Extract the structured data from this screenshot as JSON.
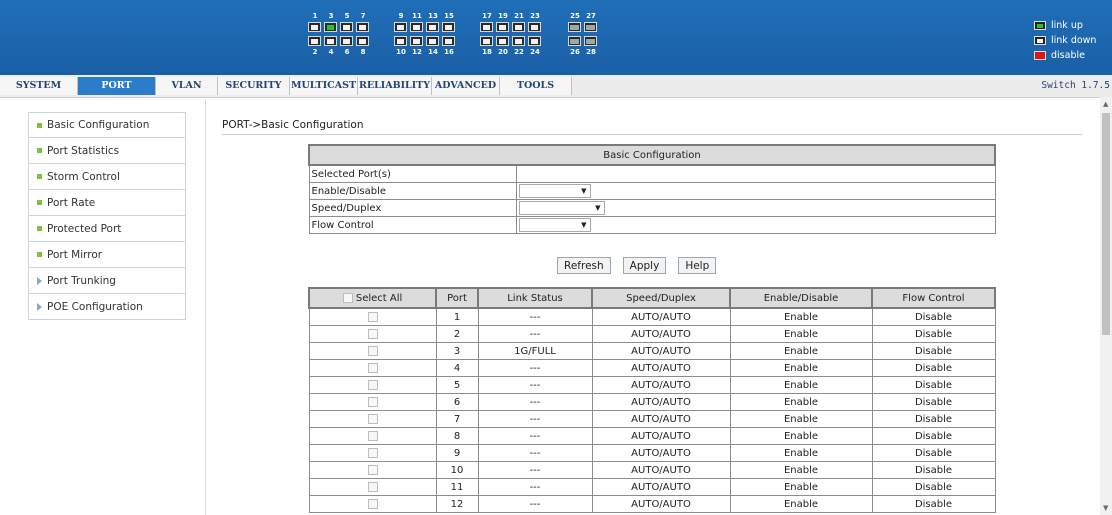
{
  "header": {
    "port_numbers_top": [
      "1",
      "3",
      "5",
      "7",
      "9",
      "11",
      "13",
      "15",
      "17",
      "19",
      "21",
      "23",
      "25",
      "27"
    ],
    "port_numbers_bottom": [
      "2",
      "4",
      "6",
      "8",
      "10",
      "12",
      "14",
      "16",
      "18",
      "20",
      "22",
      "24",
      "26",
      "28"
    ],
    "legend": {
      "link_up": "link up",
      "link_down": "link down",
      "disable": "disable"
    }
  },
  "menu": {
    "tabs": [
      "SYSTEM",
      "PORT",
      "VLAN",
      "SECURITY",
      "MULTICAST",
      "RELIABILITY",
      "ADVANCED",
      "TOOLS"
    ],
    "active": "PORT",
    "version": "Switch 1.7.5"
  },
  "sidebar": {
    "items": [
      {
        "label": "Basic Configuration",
        "icon": "square-bullet-icon"
      },
      {
        "label": "Port Statistics",
        "icon": "square-bullet-icon"
      },
      {
        "label": "Storm Control",
        "icon": "square-bullet-icon"
      },
      {
        "label": "Port Rate",
        "icon": "square-bullet-icon"
      },
      {
        "label": "Protected Port",
        "icon": "square-bullet-icon"
      },
      {
        "label": "Port Mirror",
        "icon": "square-bullet-icon"
      },
      {
        "label": "Port Trunking",
        "icon": "triangle-arrow-icon"
      },
      {
        "label": "POE Configuration",
        "icon": "triangle-arrow-icon"
      }
    ]
  },
  "main": {
    "breadcrumb": "PORT->Basic Configuration",
    "config": {
      "title": "Basic Configuration",
      "selected_ports_label": "Selected Port(s)",
      "enable_label": "Enable/Disable",
      "speed_label": "Speed/Duplex",
      "flow_label": "Flow Control"
    },
    "buttons": {
      "refresh": "Refresh",
      "apply": "Apply",
      "help": "Help"
    },
    "table": {
      "headers": [
        "Select All",
        "Port",
        "Link Status",
        "Speed/Duplex",
        "Enable/Disable",
        "Flow Control"
      ],
      "rows": [
        [
          "1",
          "---",
          "AUTO/AUTO",
          "Enable",
          "Disable"
        ],
        [
          "2",
          "---",
          "AUTO/AUTO",
          "Enable",
          "Disable"
        ],
        [
          "3",
          "1G/FULL",
          "AUTO/AUTO",
          "Enable",
          "Disable"
        ],
        [
          "4",
          "---",
          "AUTO/AUTO",
          "Enable",
          "Disable"
        ],
        [
          "5",
          "---",
          "AUTO/AUTO",
          "Enable",
          "Disable"
        ],
        [
          "6",
          "---",
          "AUTO/AUTO",
          "Enable",
          "Disable"
        ],
        [
          "7",
          "---",
          "AUTO/AUTO",
          "Enable",
          "Disable"
        ],
        [
          "8",
          "---",
          "AUTO/AUTO",
          "Enable",
          "Disable"
        ],
        [
          "9",
          "---",
          "AUTO/AUTO",
          "Enable",
          "Disable"
        ],
        [
          "10",
          "---",
          "AUTO/AUTO",
          "Enable",
          "Disable"
        ],
        [
          "11",
          "---",
          "AUTO/AUTO",
          "Enable",
          "Disable"
        ],
        [
          "12",
          "---",
          "AUTO/AUTO",
          "Enable",
          "Disable"
        ]
      ]
    }
  },
  "colors": {
    "header_blue": "#1f6fb8",
    "active_tab": "#2c7dc9",
    "link_up": "#2cc42c",
    "disable": "#d81818"
  }
}
